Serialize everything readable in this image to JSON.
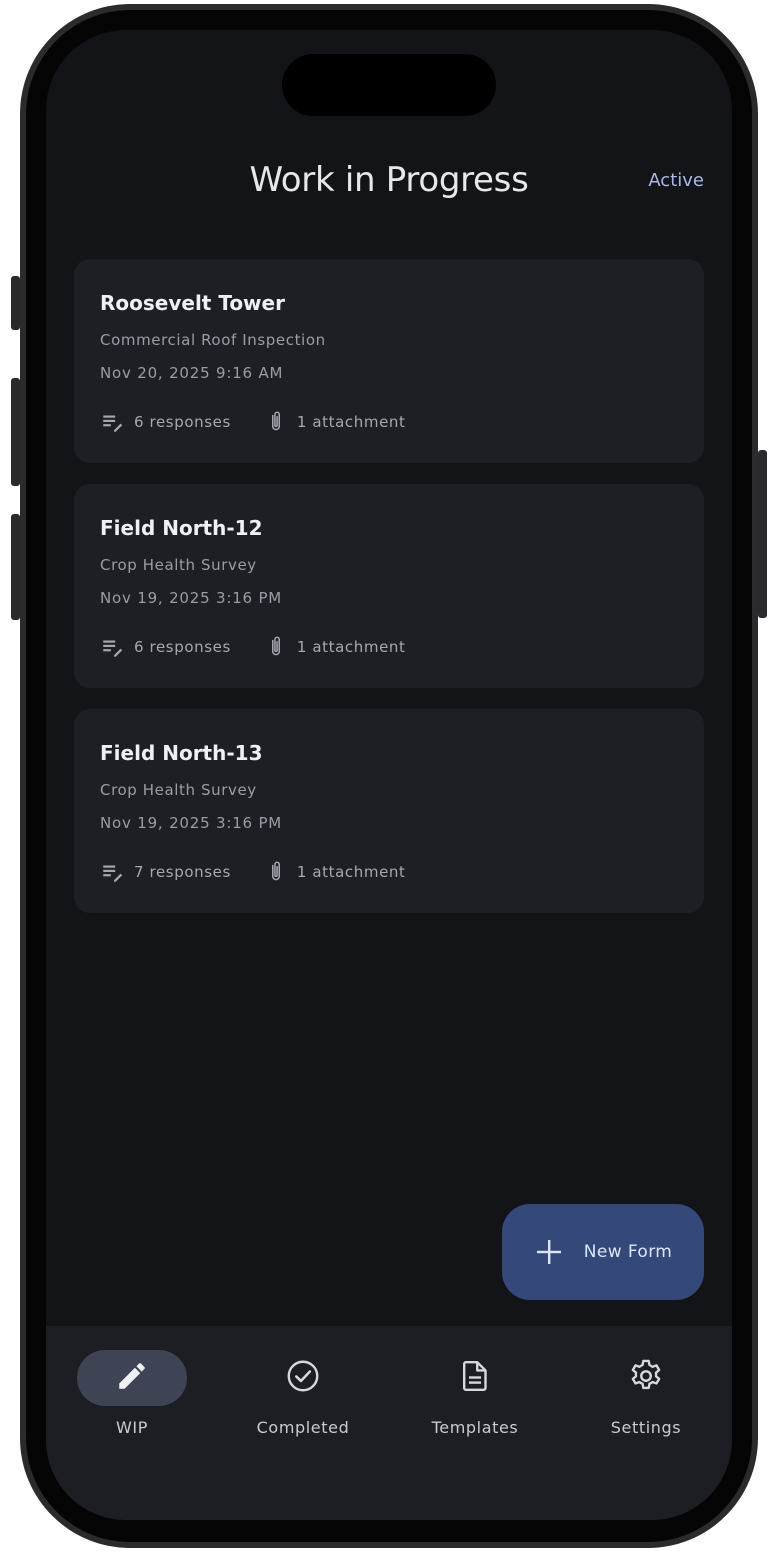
{
  "header": {
    "title": "Work in Progress",
    "status": "Active"
  },
  "forms": [
    {
      "title": "Roosevelt Tower",
      "type": "Commercial Roof Inspection",
      "date": "Nov 20, 2025 9:16 AM",
      "responses": "6 responses",
      "attachments": "1 attachment"
    },
    {
      "title": "Field North-12",
      "type": "Crop Health Survey",
      "date": "Nov 19, 2025 3:16 PM",
      "responses": "6 responses",
      "attachments": "1 attachment"
    },
    {
      "title": "Field North-13",
      "type": "Crop Health Survey",
      "date": "Nov 19, 2025 3:16 PM",
      "responses": "7 responses",
      "attachments": "1 attachment"
    }
  ],
  "fab": {
    "label": "New Form",
    "icon": "plus-icon"
  },
  "nav": {
    "items": [
      {
        "label": "WIP",
        "icon": "pencil-icon",
        "active": true
      },
      {
        "label": "Completed",
        "icon": "check-circle-icon",
        "active": false
      },
      {
        "label": "Templates",
        "icon": "document-icon",
        "active": false
      },
      {
        "label": "Settings",
        "icon": "gear-icon",
        "active": false
      }
    ]
  },
  "colors": {
    "background": "#131418",
    "card": "#1e1f24",
    "accent": "#a9b8e8",
    "fab": "#34497a",
    "nav_active_pill": "#3f4454"
  }
}
